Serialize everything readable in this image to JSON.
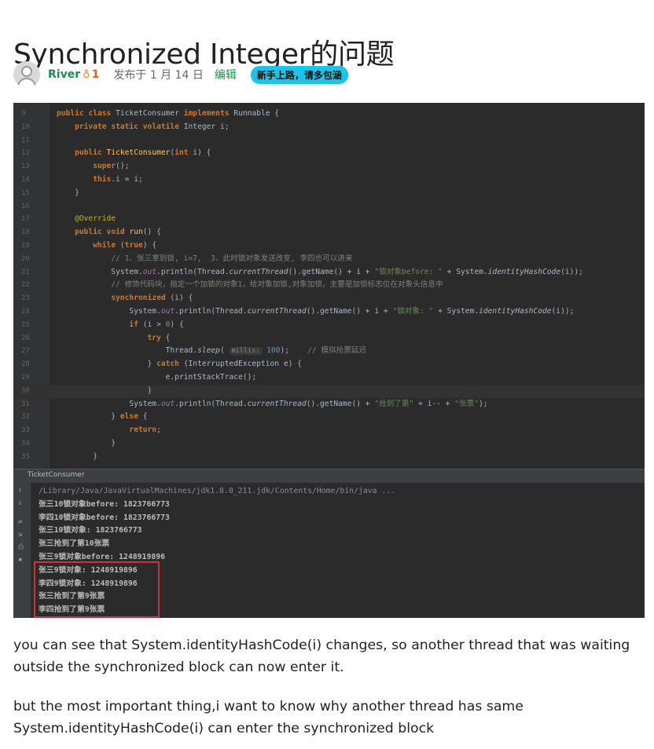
{
  "question": {
    "title": "Synchronized Integer的问题"
  },
  "meta": {
    "author": "River",
    "reputation": "1",
    "posted": "发布于 1 月 14 日",
    "edit_label": "编辑",
    "badge": "新手上路，请多包涵"
  },
  "screenshot": {
    "code_lines": [
      {
        "n": "9",
        "t": "public class TicketConsumer implements Runnable {"
      },
      {
        "n": "10",
        "t": "    private static volatile Integer i;"
      },
      {
        "n": "11",
        "t": ""
      },
      {
        "n": "12",
        "t": "    public TicketConsumer(int i) {"
      },
      {
        "n": "13",
        "t": "        super();"
      },
      {
        "n": "14",
        "t": "        this.i = i;"
      },
      {
        "n": "15",
        "t": "    }"
      },
      {
        "n": "16",
        "t": ""
      },
      {
        "n": "17",
        "t": "    @Override"
      },
      {
        "n": "18",
        "t": "    public void run() {"
      },
      {
        "n": "19",
        "t": "        while (true) {"
      },
      {
        "n": "20",
        "t": "            // 1、张三拿到锁, i=7,  3、此时锁对象发送改变, 李四也可以进来"
      },
      {
        "n": "21",
        "t": "            System.out.println(Thread.currentThread().getName() + i + \"锁对象before: \" + System.identityHashCode(i));"
      },
      {
        "n": "22",
        "t": "            // 修饰代码块，指定一个加锁的对象1，给对象加锁,对象加锁，主要是加锁标志位在对象头信息中"
      },
      {
        "n": "23",
        "t": "            synchronized (i) {"
      },
      {
        "n": "24",
        "t": "                System.out.println(Thread.currentThread().getName() + i + \"锁对象: \" + System.identityHashCode(i));"
      },
      {
        "n": "25",
        "t": "                if (i > 0) {"
      },
      {
        "n": "26",
        "t": "                    try {"
      },
      {
        "n": "27",
        "t": "                        Thread.sleep( millis: 100);    // 模拟抢票延迟"
      },
      {
        "n": "28",
        "t": "                    } catch (InterruptedException e) {"
      },
      {
        "n": "29",
        "t": "                        e.printStackTrace();"
      },
      {
        "n": "30",
        "t": "                    }"
      },
      {
        "n": "31",
        "t": "                System.out.println(Thread.currentThread().getName() + \"抢到了第\" + i-- + \"张票\");"
      },
      {
        "n": "32",
        "t": "            } else {"
      },
      {
        "n": "33",
        "t": "                return;"
      },
      {
        "n": "34",
        "t": "            }"
      },
      {
        "n": "35",
        "t": "        }"
      }
    ],
    "console_tab": "TicketConsumer",
    "console_lines": [
      "/Library/Java/JavaVirtualMachines/jdk1.8.0_211.jdk/Contents/Home/bin/java ...",
      "张三10锁对象before: 1823766773",
      "李四10锁对象before: 1823766773",
      "张三10锁对象: 1823766773",
      "张三抢到了第10张票",
      "张三9锁对象before: 1248919896",
      "张三9锁对象: 1248919896",
      "李四9锁对象: 1248919896",
      "张三抢到了第9张票",
      "李四抢到了第9张票"
    ]
  },
  "body": {
    "paragraph1": "you can see that System.identityHashCode(i) changes, so another thread that was waiting outside the synchronized block can now enter it.",
    "paragraph2": "but the most important thing,i want to know why another thread has same System.identityHashCode(i) can enter the synchronized block"
  }
}
